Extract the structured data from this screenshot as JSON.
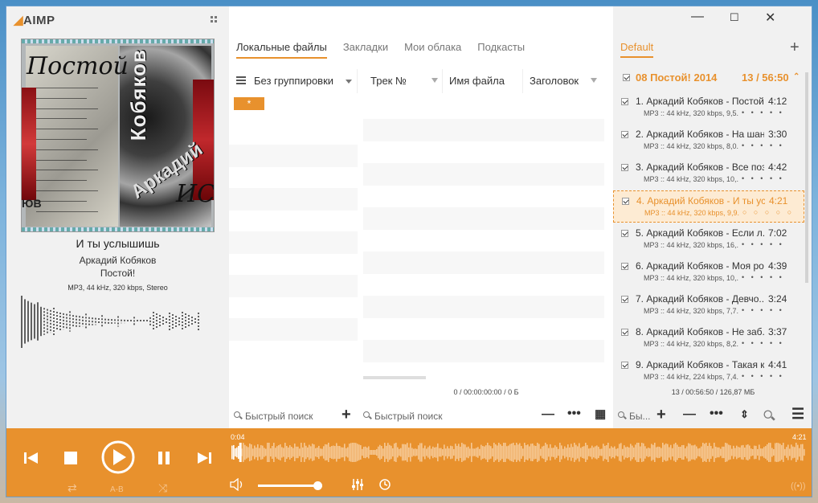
{
  "app": {
    "logo": "AIMP"
  },
  "window_controls": {
    "minimize": "—",
    "maximize": "☐",
    "close": "✕"
  },
  "now_playing": {
    "title": "И ты услышишь",
    "artist": "Аркадий Кобяков",
    "album": "Постой!",
    "info": "MP3, 44 kHz, 320 kbps, Stereo",
    "cover": {
      "top_text": "Постой",
      "name_vertical": "Кобяков",
      "name_slant": "Аркадий",
      "bottom_text": "ИС",
      "left_bottom": "ЮВ"
    }
  },
  "library": {
    "tabs": [
      {
        "label": "Локальные файлы",
        "active": true
      },
      {
        "label": "Закладки",
        "active": false
      },
      {
        "label": "Мои облака",
        "active": false
      },
      {
        "label": "Подкасты",
        "active": false
      }
    ],
    "grouping": "Без группировки",
    "columns": [
      "Трек №",
      "Имя файла",
      "Заголовок"
    ],
    "star_item": "*",
    "status": "0 / 00:00:00:00 / 0 Б",
    "search_placeholder": "Быстрый поиск"
  },
  "playlist": {
    "tab": "Default",
    "group": {
      "title": "08 Постой! 2014",
      "count": "13 / 56:50"
    },
    "tracks": [
      {
        "title": "1. Аркадий Кобяков - Постой",
        "duration": "4:12",
        "info": "MP3 :: 44 kHz, 320 kbps, 9,5...",
        "playing": false
      },
      {
        "title": "2. Аркадий Кобяков - На шан...",
        "duration": "3:30",
        "info": "MP3 :: 44 kHz, 320 kbps, 8,0...",
        "playing": false
      },
      {
        "title": "3. Аркадий Кобяков - Все поз...",
        "duration": "4:42",
        "info": "MP3 :: 44 kHz, 320 kbps, 10,...",
        "playing": false
      },
      {
        "title": "4. Аркадий Кобяков - И ты ус...",
        "duration": "4:21",
        "info": "MP3 :: 44 kHz, 320 kbps, 9,9...",
        "playing": true
      },
      {
        "title": "5. Аркадий Кобяков - Если л...",
        "duration": "7:02",
        "info": "MP3 :: 44 kHz, 320 kbps, 16,...",
        "playing": false
      },
      {
        "title": "6. Аркадий Кобяков - Моя ро...",
        "duration": "4:39",
        "info": "MP3 :: 44 kHz, 320 kbps, 10,...",
        "playing": false
      },
      {
        "title": "7. Аркадий Кобяков - Девчо...",
        "duration": "3:24",
        "info": "MP3 :: 44 kHz, 320 kbps, 7,7...",
        "playing": false
      },
      {
        "title": "8. Аркадий Кобяков - Не заб...",
        "duration": "3:37",
        "info": "MP3 :: 44 kHz, 320 kbps, 8,2...",
        "playing": false
      },
      {
        "title": "9. Аркадий Кобяков - Такая к...",
        "duration": "4:41",
        "info": "MP3 :: 44 kHz, 224 kbps, 7,4...",
        "playing": false
      }
    ],
    "rating_dots": "• • • • •",
    "rating_dots_playing": "○ ○ ○ ○ ○",
    "status": "13 / 00:56:50 / 126,87 МБ",
    "search_placeholder": "Бы..."
  },
  "player": {
    "time_current": "0:04",
    "time_total": "4:21",
    "progress": 0.015,
    "volume": 0.92,
    "ab_label": "A-B"
  },
  "colors": {
    "accent": "#e8912d"
  }
}
